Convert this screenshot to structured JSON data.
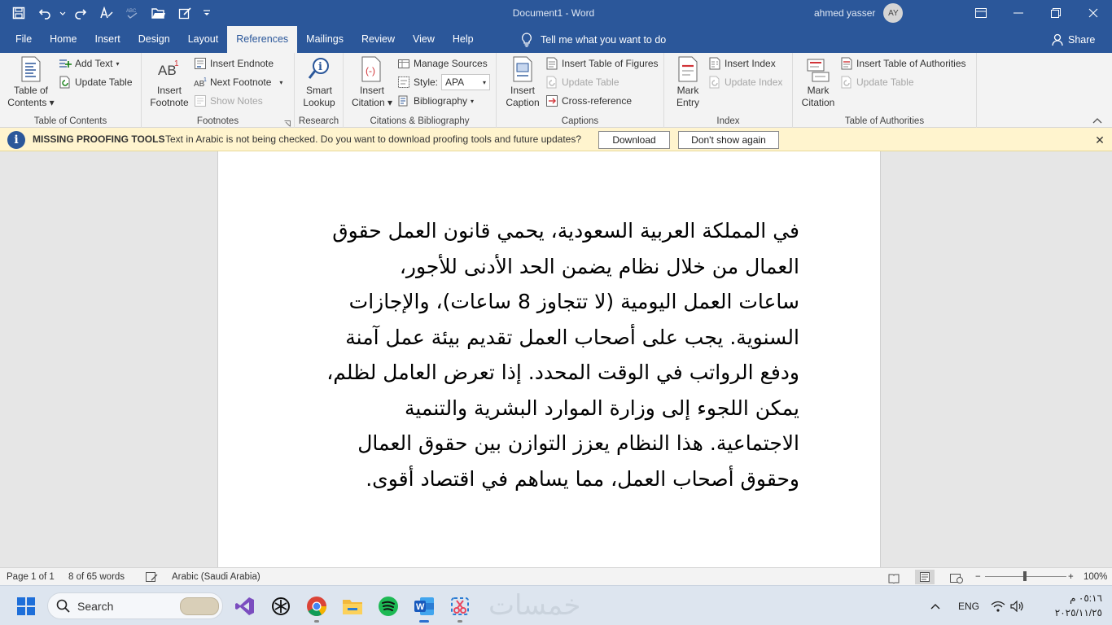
{
  "titlebar": {
    "doc_title": "Document1  -  Word",
    "user_name": "ahmed yasser",
    "user_initials": "AY",
    "qat_icons": [
      "save-icon",
      "undo-icon",
      "redo-icon",
      "format-icon",
      "spelling-icon",
      "open-folder-icon",
      "edit-icon",
      "customize-qat-icon"
    ]
  },
  "tabs": [
    "File",
    "Home",
    "Insert",
    "Design",
    "Layout",
    "References",
    "Mailings",
    "Review",
    "View",
    "Help"
  ],
  "active_tab": "References",
  "tell_me": "Tell me what you want to do",
  "share": "Share",
  "ribbon": {
    "toc": {
      "label": "Table of Contents",
      "big_line1": "Table of",
      "big_line2": "Contents",
      "add_text": "Add Text",
      "update_table": "Update Table"
    },
    "footnotes": {
      "label": "Footnotes",
      "insert_line1": "Insert",
      "insert_line2": "Footnote",
      "insert_endnote": "Insert Endnote",
      "next_footnote": "Next Footnote",
      "show_notes": "Show Notes"
    },
    "research": {
      "label": "Research",
      "line1": "Smart",
      "line2": "Lookup"
    },
    "citations": {
      "label": "Citations & Bibliography",
      "insert_line1": "Insert",
      "insert_line2": "Citation",
      "manage_sources": "Manage Sources",
      "style_label": "Style:",
      "style_value": "APA",
      "bibliography": "Bibliography"
    },
    "captions": {
      "label": "Captions",
      "insert_line1": "Insert",
      "insert_line2": "Caption",
      "insert_tof": "Insert Table of Figures",
      "update_table": "Update Table",
      "cross_reference": "Cross-reference"
    },
    "index": {
      "label": "Index",
      "mark_line1": "Mark",
      "mark_line2": "Entry",
      "insert_index": "Insert Index",
      "update_index": "Update Index"
    },
    "toa": {
      "label": "Table of Authorities",
      "mark_line1": "Mark",
      "mark_line2": "Citation",
      "insert_toa": "Insert Table of Authorities",
      "update_table": "Update Table"
    }
  },
  "message_bar": {
    "title": "MISSING PROOFING TOOLS",
    "text": "Text in Arabic is not being checked. Do you want to download proofing tools and future updates?",
    "download": "Download",
    "dont_show": "Don't show again"
  },
  "document": {
    "lines": [
      "في المملكة العربية السعودية، يحمي قانون العمل حقوق",
      "العمال من خلال نظام يضمن الحد الأدنى للأجور،",
      "ساعات العمل اليومية (لا تتجاوز 8 ساعات)، والإجازات",
      "السنوية. يجب على أصحاب العمل تقديم بيئة عمل آمنة",
      "ودفع الرواتب في الوقت المحدد. إذا تعرض العامل لظلم،",
      "يمكن اللجوء إلى وزارة الموارد البشرية والتنمية",
      "الاجتماعية. هذا النظام يعزز التوازن بين حقوق العمال",
      "وحقوق أصحاب العمل، مما يساهم في اقتصاد أقوى."
    ]
  },
  "statusbar": {
    "page": "Page 1 of 1",
    "words": "8 of 65 words",
    "language": "Arabic (Saudi Arabia)",
    "zoom": "100%",
    "zoom_percent": 100
  },
  "taskbar": {
    "search_placeholder": "Search",
    "watermark": "خمسات",
    "lang": "ENG",
    "time": "٠٥:١٦ م",
    "date": "٢٠٢٥/١١/٢٥",
    "apps": [
      "visual-studio-icon",
      "chatgpt-icon",
      "chrome-icon",
      "file-explorer-icon",
      "spotify-icon",
      "word-icon",
      "snipping-tool-icon"
    ]
  }
}
